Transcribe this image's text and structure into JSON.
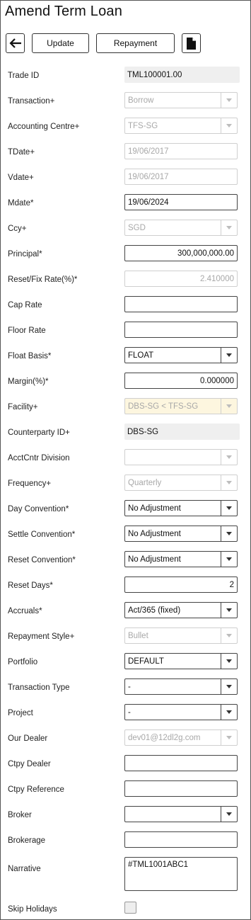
{
  "page": {
    "title": "Amend Term Loan"
  },
  "toolbar": {
    "update_label": "Update",
    "repayment_label": "Repayment",
    "back_icon": "arrow-left-icon",
    "doc_icon": "document-icon"
  },
  "fields": {
    "trade_id": {
      "label": "Trade ID",
      "value": "TML100001.00"
    },
    "transaction": {
      "label": "Transaction+",
      "value": "Borrow"
    },
    "accounting_centre": {
      "label": "Accounting Centre+",
      "value": "TFS-SG"
    },
    "tdate": {
      "label": "TDate+",
      "value": "19/06/2017"
    },
    "vdate": {
      "label": "Vdate+",
      "value": "19/06/2017"
    },
    "mdate": {
      "label": "Mdate*",
      "value": "19/06/2024"
    },
    "ccy": {
      "label": "Ccy+",
      "value": "SGD"
    },
    "principal": {
      "label": "Principal*",
      "value": "300,000,000.00"
    },
    "reset_rate": {
      "label": "Reset/Fix Rate(%)*",
      "value": "2.410000"
    },
    "cap_rate": {
      "label": "Cap Rate",
      "value": ""
    },
    "floor_rate": {
      "label": "Floor Rate",
      "value": ""
    },
    "float_basis": {
      "label": "Float Basis*",
      "value": "FLOAT"
    },
    "margin": {
      "label": "Margin(%)*",
      "value": "0.000000"
    },
    "facility": {
      "label": "Facility+",
      "value": "DBS-SG < TFS-SG"
    },
    "counterparty_id": {
      "label": "Counterparty ID+",
      "value": "DBS-SG"
    },
    "acctcntr_division": {
      "label": "AcctCntr Division",
      "value": ""
    },
    "frequency": {
      "label": "Frequency+",
      "value": "Quarterly"
    },
    "day_convention": {
      "label": "Day Convention*",
      "value": "No Adjustment"
    },
    "settle_convention": {
      "label": "Settle Convention*",
      "value": "No Adjustment"
    },
    "reset_convention": {
      "label": "Reset Convention*",
      "value": "No Adjustment"
    },
    "reset_days": {
      "label": "Reset Days*",
      "value": "2"
    },
    "accruals": {
      "label": "Accruals*",
      "value": "Act/365 (fixed)"
    },
    "repayment_style": {
      "label": "Repayment Style+",
      "value": "Bullet"
    },
    "portfolio": {
      "label": "Portfolio",
      "value": "DEFAULT"
    },
    "transaction_type": {
      "label": "Transaction Type",
      "value": "-"
    },
    "project": {
      "label": "Project",
      "value": "-"
    },
    "our_dealer": {
      "label": "Our Dealer",
      "value": "dev01@12dl2g.com"
    },
    "ctpy_dealer": {
      "label": "Ctpy Dealer",
      "value": ""
    },
    "ctpy_reference": {
      "label": "Ctpy Reference",
      "value": ""
    },
    "broker": {
      "label": "Broker",
      "value": ""
    },
    "brokerage": {
      "label": "Brokerage",
      "value": ""
    },
    "narrative": {
      "label": "Narrative",
      "value": "#TML1001ABC1"
    },
    "skip_holidays": {
      "label": "Skip Holidays",
      "checked": false
    }
  }
}
